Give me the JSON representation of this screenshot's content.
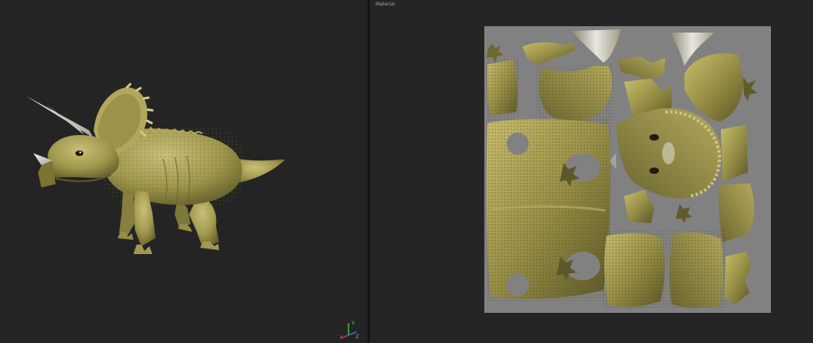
{
  "uv_editor": {
    "panel_title": "Material"
  },
  "gizmo": {
    "y_label": "Y",
    "x_label": "X",
    "z_label": "Z"
  },
  "colors": {
    "background": "#242424",
    "uv_canvas": "#818181",
    "skin_light": "#c3ba70",
    "skin_mid": "#9a9348",
    "skin_dark": "#5e5a28",
    "horn": "#cfcfc6",
    "axis_x": "#d94040",
    "axis_y": "#4fbf4f",
    "axis_z": "#4a78d8"
  },
  "icons": {
    "model": "triceratops-model",
    "uv_islands": "texture-uv-islands",
    "axis_gizmo": "xyz-axis-gizmo"
  }
}
